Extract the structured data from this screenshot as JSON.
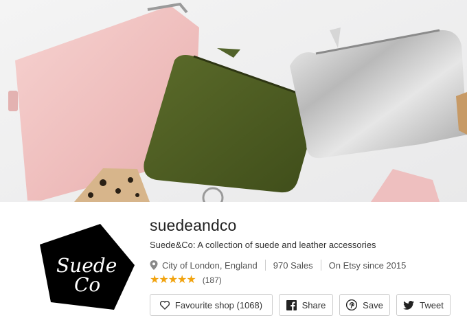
{
  "banner": {
    "alt_theme": "product-photo-pouches"
  },
  "shop": {
    "name": "suedeandco",
    "title": "Suede&Co: A collection of suede and leather accessories",
    "location": "City of London, England",
    "sales": "970 Sales",
    "since": "On Etsy since 2015",
    "rating_stars": 5,
    "stars_text": "★★★★★",
    "review_count": "(187)"
  },
  "logo": {
    "text_line1": "Suede",
    "text_line2": "Co"
  },
  "actions": {
    "favourite_label": "Favourite shop (1068)",
    "share_label": "Share",
    "save_label": "Save",
    "tweet_label": "Tweet"
  },
  "colors": {
    "star": "#f1a30f",
    "button_border": "#cccccc",
    "pink_pouch": "#f0c4c4",
    "green_pouch": "#4f5f22",
    "silver_pouch": "#c9c9c9"
  }
}
